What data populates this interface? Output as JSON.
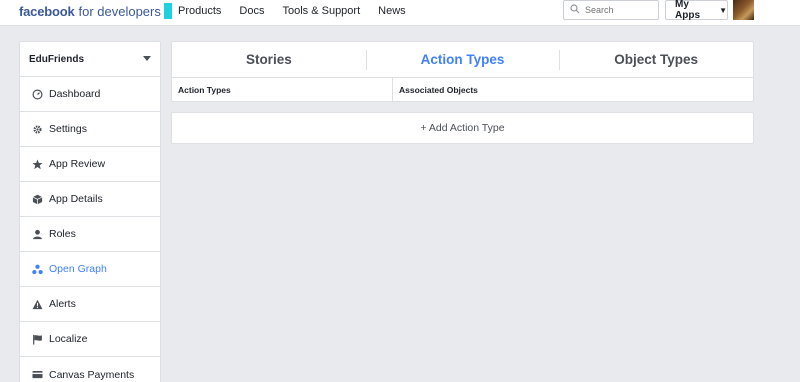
{
  "brand": {
    "name": "facebook",
    "suffix": "for developers",
    "accent": "#1ed0e0"
  },
  "nav": {
    "items": [
      "Products",
      "Docs",
      "Tools & Support",
      "News"
    ]
  },
  "search": {
    "placeholder": "Search"
  },
  "account": {
    "my_apps_label": "My Apps"
  },
  "sidebar": {
    "app_name": "EduFriends",
    "items": [
      {
        "label": "Dashboard",
        "icon": "dashboard-icon"
      },
      {
        "label": "Settings",
        "icon": "gear-icon"
      },
      {
        "label": "App Review",
        "icon": "star-icon"
      },
      {
        "label": "App Details",
        "icon": "cube-icon"
      },
      {
        "label": "Roles",
        "icon": "person-icon"
      },
      {
        "label": "Open Graph",
        "icon": "open-graph-icon",
        "active": true
      },
      {
        "label": "Alerts",
        "icon": "warning-icon"
      },
      {
        "label": "Localize",
        "icon": "flag-icon"
      },
      {
        "label": "Canvas Payments",
        "icon": "card-icon"
      }
    ]
  },
  "main": {
    "tabs": [
      {
        "label": "Stories"
      },
      {
        "label": "Action Types",
        "active": true
      },
      {
        "label": "Object Types"
      }
    ],
    "table": {
      "columns": [
        "Action Types",
        "Associated Objects"
      ]
    },
    "add_button_label": "+ Add Action Type"
  },
  "colors": {
    "link_blue": "#4080ff",
    "brand_blue": "#3b5998",
    "background": "#e9eaed"
  }
}
